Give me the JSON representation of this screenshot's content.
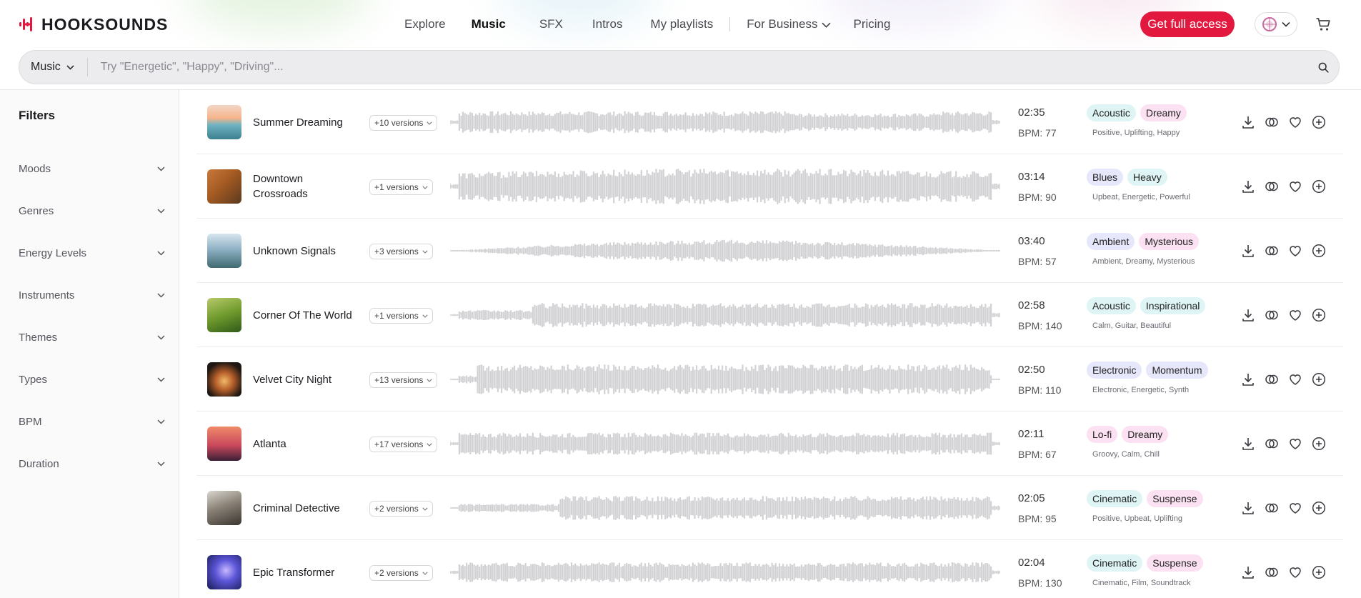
{
  "header": {
    "logo_text": "HOOKSOUNDS",
    "nav": [
      {
        "label": "Explore",
        "active": false
      },
      {
        "label": "Music",
        "active": true
      },
      {
        "label": "SFX",
        "active": false
      },
      {
        "label": "Intros",
        "active": false
      },
      {
        "label": "My playlists",
        "active": false
      },
      {
        "label": "For Business",
        "active": false,
        "dropdown": true
      },
      {
        "label": "Pricing",
        "active": false
      }
    ],
    "cta_label": "Get full access",
    "language_icon": "globe-icon",
    "cart_icon": "cart-icon",
    "accent_color": "#e2183f"
  },
  "search": {
    "type_value": "Music",
    "placeholder": "Try \"Energetic\", \"Happy\", \"Driving\"..."
  },
  "filters": {
    "title": "Filters",
    "items": [
      "Moods",
      "Genres",
      "Energy Levels",
      "Instruments",
      "Themes",
      "Types",
      "BPM",
      "Duration"
    ]
  },
  "tracks": [
    {
      "title": "Summer Dreaming",
      "versions": "+10 versions",
      "duration": "02:35",
      "bpm": "BPM: 77",
      "tags": [
        {
          "label": "Acoustic",
          "color": "#def4f5"
        },
        {
          "label": "Dreamy",
          "color": "#fbe1f1"
        }
      ],
      "subtags": "Positive, Uplifting, Happy"
    },
    {
      "title": "Downtown Crossroads",
      "versions": "+1 versions",
      "duration": "03:14",
      "bpm": "BPM: 90",
      "tags": [
        {
          "label": "Blues",
          "color": "#e7e7fb"
        },
        {
          "label": "Heavy",
          "color": "#def4f5"
        }
      ],
      "subtags": "Upbeat, Energetic, Powerful"
    },
    {
      "title": "Unknown Signals",
      "versions": "+3 versions",
      "duration": "03:40",
      "bpm": "BPM: 57",
      "tags": [
        {
          "label": "Ambient",
          "color": "#e7e7fb"
        },
        {
          "label": "Mysterious",
          "color": "#fbe1f1"
        }
      ],
      "subtags": "Ambient, Dreamy, Mysterious"
    },
    {
      "title": "Corner Of The World",
      "versions": "+1 versions",
      "duration": "02:58",
      "bpm": "BPM: 140",
      "tags": [
        {
          "label": "Acoustic",
          "color": "#def4f5"
        },
        {
          "label": "Inspirational",
          "color": "#def4f5"
        }
      ],
      "subtags": "Calm, Guitar, Beautiful"
    },
    {
      "title": "Velvet City Night",
      "versions": "+13 versions",
      "duration": "02:50",
      "bpm": "BPM: 110",
      "tags": [
        {
          "label": "Electronic",
          "color": "#e7e7fb"
        },
        {
          "label": "Momentum",
          "color": "#e7e7fb"
        }
      ],
      "subtags": "Electronic, Energetic, Synth"
    },
    {
      "title": "Atlanta",
      "versions": "+17 versions",
      "duration": "02:11",
      "bpm": "BPM: 67",
      "tags": [
        {
          "label": "Lo-fi",
          "color": "#fbe1f1"
        },
        {
          "label": "Dreamy",
          "color": "#fbe1f1"
        }
      ],
      "subtags": "Groovy, Calm, Chill"
    },
    {
      "title": "Criminal Detective",
      "versions": "+2 versions",
      "duration": "02:05",
      "bpm": "BPM: 95",
      "tags": [
        {
          "label": "Cinematic",
          "color": "#def4f5"
        },
        {
          "label": "Suspense",
          "color": "#fbe1f1"
        }
      ],
      "subtags": "Positive, Upbeat, Uplifting"
    },
    {
      "title": "Epic Transformer",
      "versions": "+2 versions",
      "duration": "02:04",
      "bpm": "BPM: 130",
      "tags": [
        {
          "label": "Cinematic",
          "color": "#def4f5"
        },
        {
          "label": "Suspense",
          "color": "#fbe1f1"
        }
      ],
      "subtags": "Cinematic, Film, Soundtrack"
    }
  ],
  "track_actions": [
    "download-icon",
    "similar-icon",
    "heart-icon",
    "add-icon"
  ]
}
